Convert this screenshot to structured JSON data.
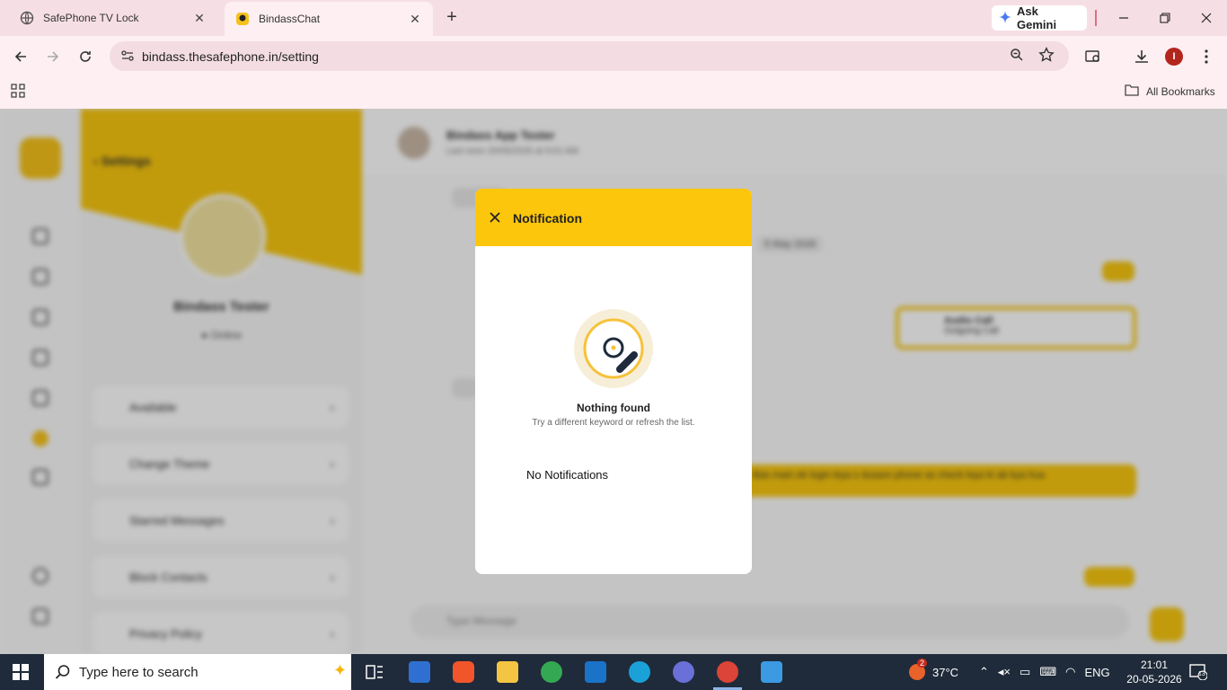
{
  "browser": {
    "tabs": [
      {
        "title": "SafePhone TV Lock",
        "active": false
      },
      {
        "title": "BindassChat",
        "active": true
      }
    ],
    "gemini_label": "Ask Gemini",
    "url": "bindass.thesafephone.in/setting",
    "profile_initial": "I",
    "all_bookmarks": "All Bookmarks"
  },
  "app": {
    "settings_title": "Settings",
    "profile_name": "Bindass Tester",
    "profile_status": "Online",
    "menu": [
      "Available",
      "Change Theme",
      "Starred Messages",
      "Block Contacts",
      "Privacy Policy"
    ],
    "chat_name": "Bindass App Tester",
    "chat_sub": "Last seen 20/05/2026 at 9:01 AM",
    "date_chip": "5 May 2026",
    "call_title": "Audio Call",
    "call_sub": "Outgoing Call",
    "long_msg": "Bas main ek login kiya s dusare phone se check kiya ki ab kya hua",
    "input_placeholder": "Type Message"
  },
  "modal": {
    "title": "Notification",
    "empty_title": "Nothing found",
    "empty_subtitle": "Try a different keyword or refresh the list.",
    "message": "No Notifications"
  },
  "taskbar": {
    "search_placeholder": "Type here to search",
    "weather": "37°C",
    "weather_badge": "2",
    "language": "ENG",
    "time": "21:01",
    "date": "20-05-2026",
    "notification_count": "13"
  },
  "colors": {
    "accent_yellow": "#fcc60c",
    "tab_strip": "#f6dfe4",
    "taskbar": "#1f2b3a"
  }
}
